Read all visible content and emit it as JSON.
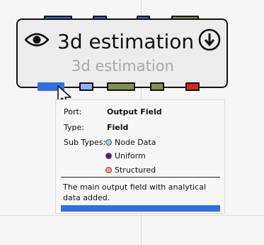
{
  "node": {
    "title": "3d estimation",
    "subtitle": "3d estimation",
    "icons": [
      "eye-icon",
      "download-icon"
    ]
  },
  "ports": {
    "top": [
      {
        "name": "top-port-1",
        "color": "#2f6fe0"
      },
      {
        "name": "top-port-2",
        "color": "#2f6fe0"
      },
      {
        "name": "top-port-3",
        "color": "#2f6fe0"
      },
      {
        "name": "top-port-4",
        "color": "#7f9150"
      }
    ],
    "bottom": [
      {
        "name": "bottom-port-output-field",
        "color": "#2f6fe0"
      },
      {
        "name": "bottom-port-2",
        "color": "#8fb0ee"
      },
      {
        "name": "bottom-port-3",
        "color": "#7f9150"
      },
      {
        "name": "bottom-port-4",
        "color": "#7f9150"
      },
      {
        "name": "bottom-port-5",
        "color": "#dd2020"
      }
    ]
  },
  "tooltip": {
    "port_label": "Port:",
    "port_value": "Output Field",
    "type_label": "Type:",
    "type_value": "Field",
    "subtypes_label": "Sub Types:",
    "subtypes": [
      {
        "label": "Node Data",
        "color": "#8fd0e8"
      },
      {
        "label": "Uniform",
        "color": "#6a0f80"
      },
      {
        "label": "Structured",
        "color": "#f0a080"
      }
    ],
    "description": "The main output field with analytical data added.",
    "accent_color": "#2f6fe0"
  }
}
